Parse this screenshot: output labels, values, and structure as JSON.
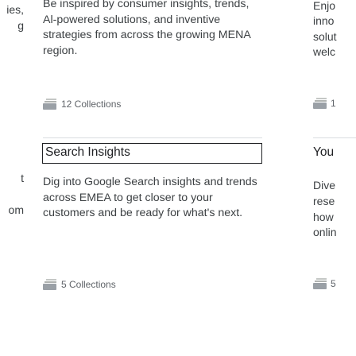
{
  "left_card": {
    "lines": [
      "ies,",
      "g",
      "t",
      "om"
    ]
  },
  "center_top_card": {
    "description": "Be inspired by consumer insights, trends, Al-powered solutions, and inventive strategies from across the growing MENA region.",
    "collections_count": "12 Collections"
  },
  "center_card": {
    "title": "Search Insights",
    "description": "Dig into Google Search insights and trends across EMEA to get closer to your customers and be ready for what's next.",
    "collections_count": "5 Collections"
  },
  "right_top_card": {
    "lines": [
      "Enjo",
      "inno",
      "solut",
      "welc"
    ],
    "collections_count": "1"
  },
  "right_card": {
    "title": "You",
    "lines": [
      "Dive",
      "rese",
      "how",
      "onlin"
    ],
    "collections_count": "5"
  },
  "icons": {
    "collections": "collections-icon"
  },
  "colors": {
    "text": "#3c4043",
    "title": "#202124",
    "meta": "#5f6368",
    "icon": "#9aa0a6",
    "divider": "#dadce0"
  }
}
